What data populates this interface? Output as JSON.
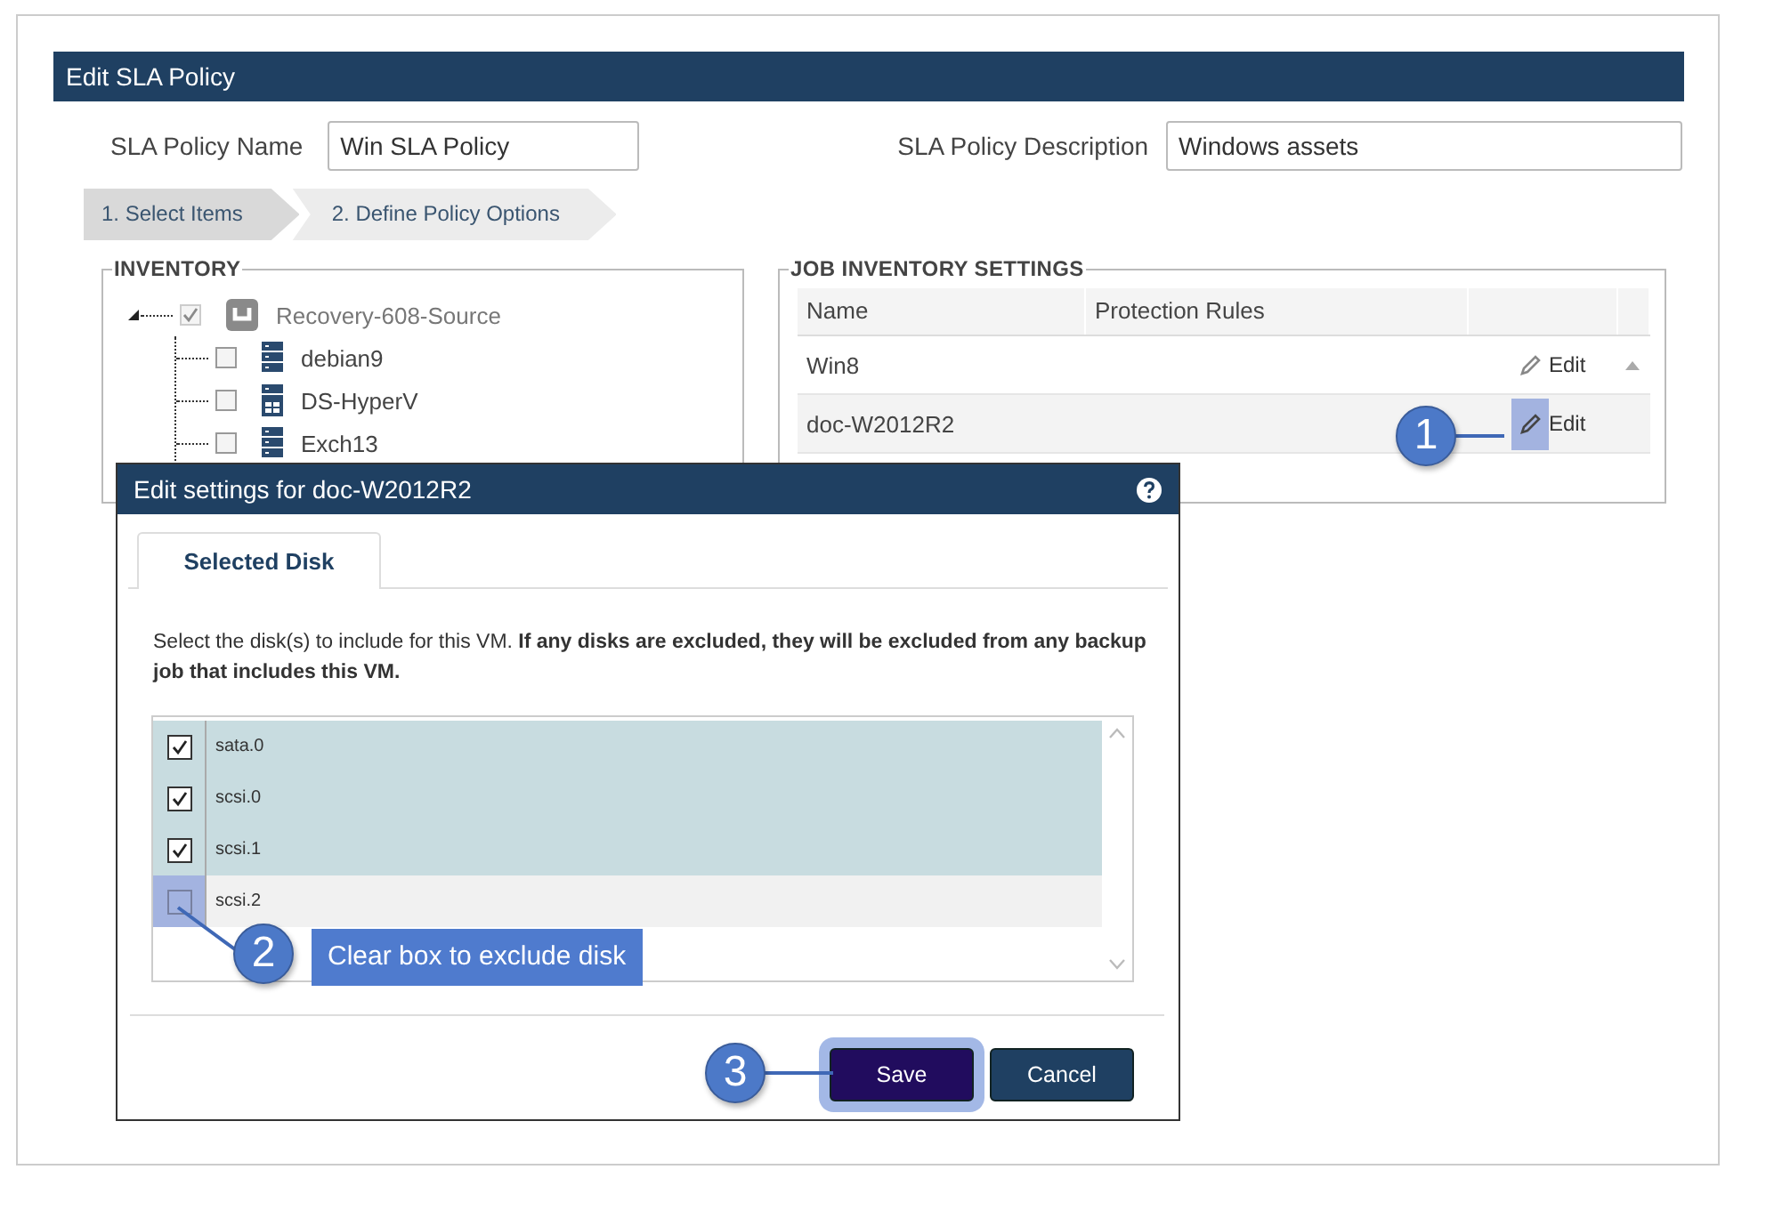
{
  "page": {
    "title": "Edit SLA Policy",
    "fields": [
      {
        "label": "SLA Policy Name",
        "value": "Win SLA Policy"
      },
      {
        "label": "SLA Policy Description",
        "value": "Windows assets"
      }
    ],
    "steps": [
      {
        "label": "1. Select Items",
        "selected": true
      },
      {
        "label": "2. Define Policy Options",
        "selected": false
      }
    ]
  },
  "inventory": {
    "title": "INVENTORY",
    "tree": [
      {
        "label": "Recovery-608-Source",
        "kind": "source",
        "checked": true,
        "disabled": true,
        "children": [
          {
            "label": "debian9",
            "kind": "server",
            "checked": false,
            "disabled": false
          },
          {
            "label": "DS-HyperV",
            "kind": "host",
            "checked": false,
            "disabled": false
          },
          {
            "label": "Exch13",
            "kind": "server",
            "checked": false,
            "disabled": false
          }
        ]
      }
    ]
  },
  "job_inventory": {
    "title": "JOB INVENTORY SETTINGS",
    "columns": [
      "Name",
      "Protection Rules"
    ],
    "rows": [
      {
        "name": "Win8",
        "action": "Edit",
        "selected": false
      },
      {
        "name": "doc-W2012R2",
        "action": "Edit",
        "selected": true
      }
    ]
  },
  "dialog": {
    "title": "Edit settings for doc-W2012R2",
    "tabs": [
      {
        "label": "Selected Disk",
        "selected": true
      }
    ],
    "instructions": "Select the disk(s) to include for this VM. **If any disks are excluded, they will be excluded from any backup job that includes this VM.**",
    "disks": [
      {
        "name": "sata.0",
        "checked": true
      },
      {
        "name": "scsi.0",
        "checked": true
      },
      {
        "name": "scsi.1",
        "checked": true
      },
      {
        "name": "scsi.2",
        "checked": false
      }
    ],
    "buttons": [
      {
        "label": "Save",
        "kind": "primary"
      },
      {
        "label": "Cancel",
        "kind": "secondary"
      }
    ]
  },
  "callouts": [
    {
      "number": "1"
    },
    {
      "number": "2",
      "text": "Clear box to exclude disk"
    },
    {
      "number": "3"
    }
  ]
}
